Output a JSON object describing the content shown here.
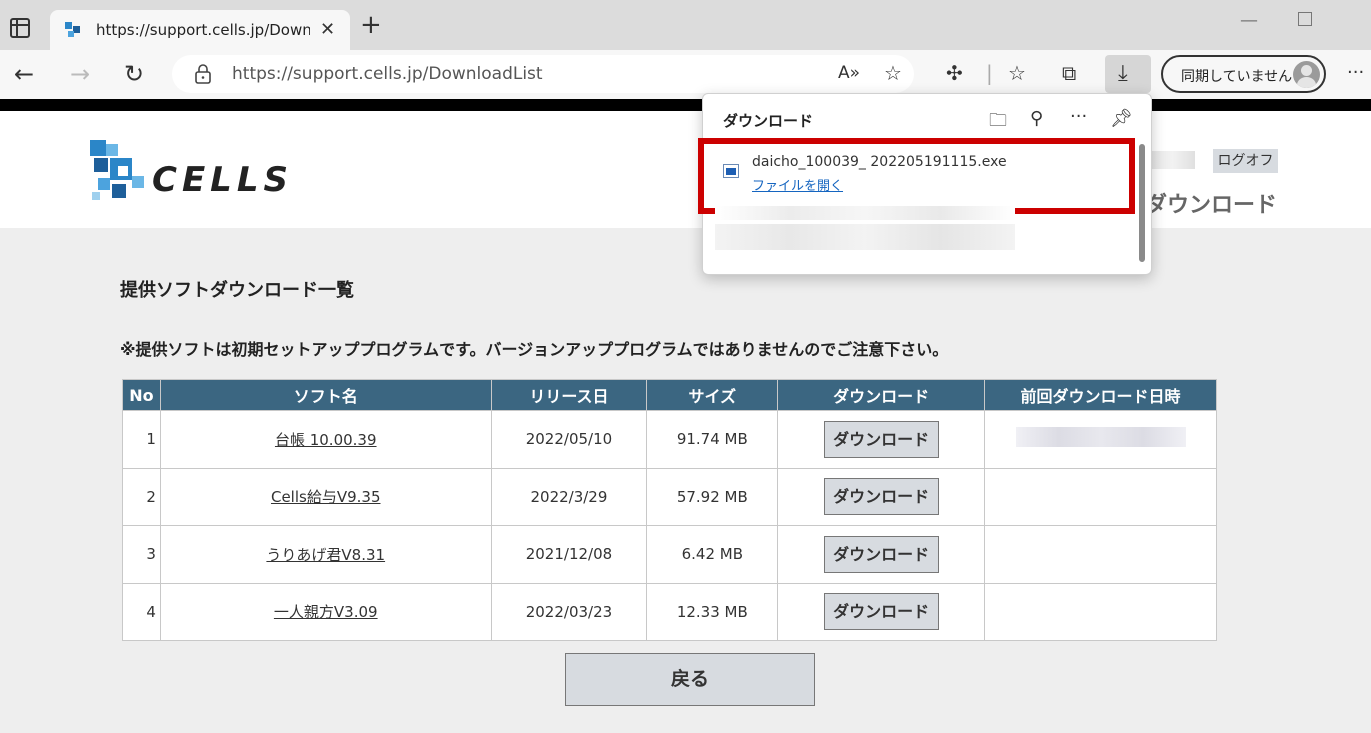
{
  "browser": {
    "tab_title": "https://support.cells.jp/DownloadList",
    "url": "https://support.cells.jp/DownloadList",
    "sync_label": "同期していません"
  },
  "header": {
    "logo_text": "CELLS",
    "logoff_label": "ログオフ",
    "section_label": "ダウンロード"
  },
  "main": {
    "title": "提供ソフトダウンロード一覧",
    "notice": "※提供ソフトは初期セットアッププログラムです。バージョンアッププログラムではありませんのでご注意下さい。",
    "columns": [
      "No",
      "ソフト名",
      "リリース日",
      "サイズ",
      "ダウンロード",
      "前回ダウンロード日時"
    ],
    "rows": [
      {
        "no": "1",
        "name": "台帳 10.00.39",
        "date": "2022/05/10",
        "size": "91.74 MB",
        "button": "ダウンロード"
      },
      {
        "no": "2",
        "name": "Cells給与V9.35",
        "date": "2022/3/29",
        "size": "57.92 MB",
        "button": "ダウンロード"
      },
      {
        "no": "3",
        "name": "うりあげ君V8.31",
        "date": "2021/12/08",
        "size": "6.42 MB",
        "button": "ダウンロード"
      },
      {
        "no": "4",
        "name": "一人親方V3.09",
        "date": "2022/03/23",
        "size": "12.33 MB",
        "button": "ダウンロード"
      }
    ],
    "back_label": "戻る"
  },
  "download_panel": {
    "title": "ダウンロード",
    "file_name": "daicho_100039_ 202205191115.exe",
    "open_file_label": "ファイルを開く"
  },
  "colors": {
    "table_header": "#3b6681",
    "highlight_border": "#cc0000",
    "link_blue": "#1565c0"
  }
}
